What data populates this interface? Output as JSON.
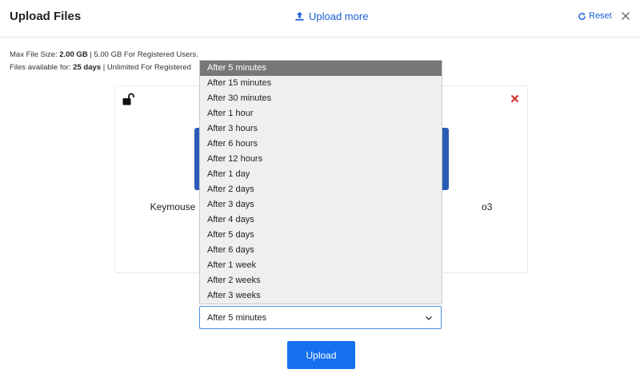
{
  "header": {
    "title": "Upload Files",
    "upload_more_label": "Upload more",
    "reset_label": "Reset",
    "accent_color": "#1a5fd6"
  },
  "info": {
    "max_size_prefix": "Max File Size: ",
    "max_size_value": "2.00 GB",
    "max_size_suffix": " | 5.00 GB For Registered Users.",
    "available_prefix": "Files available for: ",
    "available_value": "25 days",
    "available_suffix": " | Unlimited For Registered"
  },
  "file_card": {
    "file_name_left": "Keymouse",
    "file_name_right": "o3"
  },
  "expiry": {
    "selected": "After 5 minutes",
    "options": [
      "After 5 minutes",
      "After 15 minutes",
      "After 30 minutes",
      "After 1 hour",
      "After 3 hours",
      "After 6 hours",
      "After 12 hours",
      "After 1 day",
      "After 2 days",
      "After 3 days",
      "After 4 days",
      "After 5 days",
      "After 6 days",
      "After 1 week",
      "After 2 weeks",
      "After 3 weeks"
    ]
  },
  "upload_button_label": "Upload",
  "icons": {
    "upload": "upload-icon",
    "reset": "refresh-icon",
    "close": "close-icon",
    "lock": "unlock-icon",
    "remove": "remove-icon",
    "chevron": "chevron-down-icon"
  }
}
